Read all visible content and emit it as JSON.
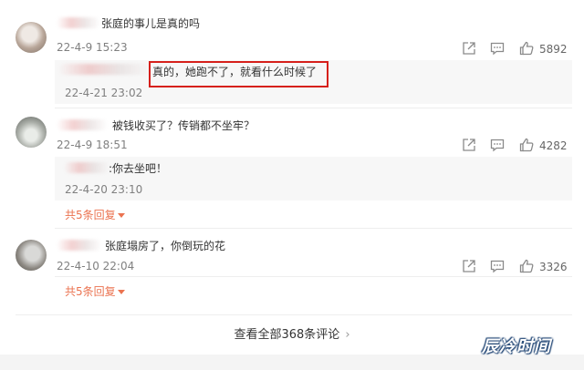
{
  "comments": [
    {
      "text": "张庭的事儿是真的吗",
      "time": "22-4-9 15:23",
      "likes": "5892",
      "reply": {
        "text": "真的，她跑不了，就看什么时候了",
        "time": "22-4-21 23:02",
        "highlighted": true
      }
    },
    {
      "text": "被钱收买了？传销都不坐牢？",
      "time": "22-4-9 18:51",
      "likes": "4282",
      "reply": {
        "text": ":你去坐吧！",
        "time": "22-4-20 23:10"
      },
      "more_replies": "共5条回复"
    },
    {
      "text": "张庭塌房了，你倒玩的花",
      "time": "22-4-10 22:04",
      "likes": "3326",
      "more_replies": "共5条回复"
    }
  ],
  "view_all": "查看全部368条评论",
  "watermark": "辰冷时间",
  "icons": [
    "share-icon",
    "comment-icon",
    "like-icon"
  ],
  "colors": {
    "highlight_border": "#d6201b",
    "more_link": "#eb7350"
  }
}
